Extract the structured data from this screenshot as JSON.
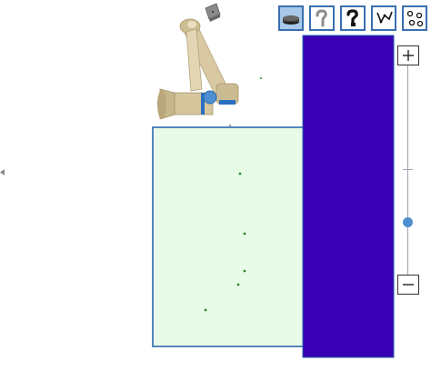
{
  "toolbar": {
    "buttons": [
      {
        "id": "base-view",
        "icon": "robot-base-icon",
        "active": true
      },
      {
        "id": "shoulder-view",
        "icon": "robot-arm-light-icon",
        "active": false
      },
      {
        "id": "arm-view",
        "icon": "robot-arm-bold-icon",
        "active": false
      },
      {
        "id": "joint-view",
        "icon": "joint-path-icon",
        "active": false
      },
      {
        "id": "points-view",
        "icon": "waypoints-icon",
        "active": false
      }
    ]
  },
  "zoom": {
    "in_icon": "plus-icon",
    "out_icon": "minus-icon",
    "level": 0.25
  },
  "colors": {
    "workspace_fill": "#e8fbe8",
    "workspace_border": "#1f5fa8",
    "obstacle_fill": "#3a00b5",
    "obstacle_border": "#1f5fa8",
    "accent": "#4d8fd1",
    "point_color": "#2e8b2e"
  }
}
